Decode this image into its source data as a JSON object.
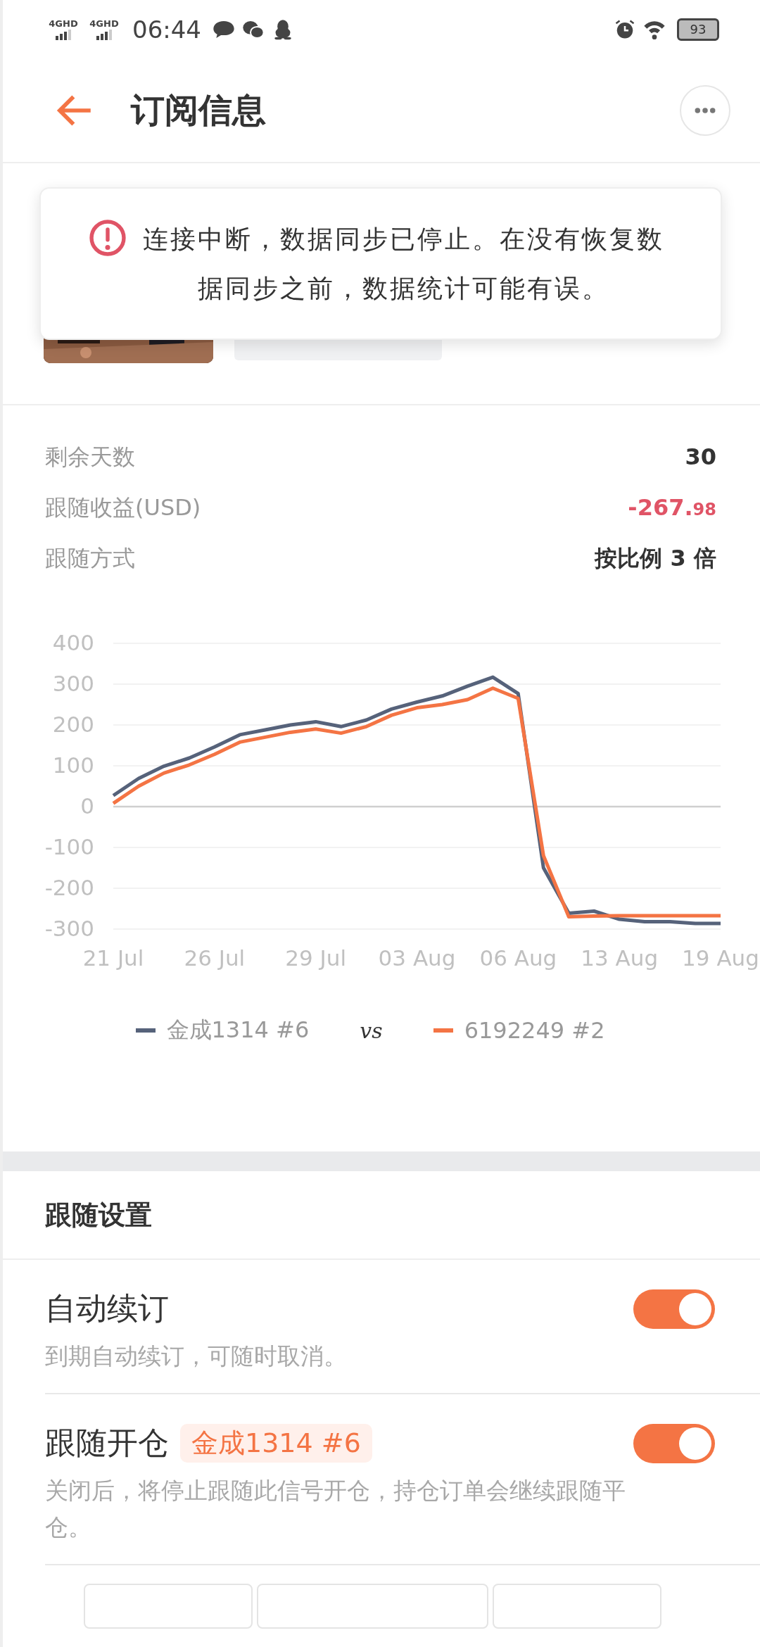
{
  "status_bar": {
    "networks": [
      "4GHD",
      "4GHD"
    ],
    "time": "06:44",
    "battery": "93"
  },
  "header": {
    "title": "订阅信息"
  },
  "toast": {
    "message": "连接中断，数据同步已停止。在没有恢复数据同步之前，数据统计可能有误。"
  },
  "info_rows": [
    {
      "label": "剩余天数",
      "value": "30",
      "color": "#333333"
    },
    {
      "label": "跟随收益(USD)",
      "value": "-267.",
      "decimals": "98",
      "color": "#e05466"
    },
    {
      "label": "跟随方式",
      "value": "按比例 3 倍",
      "color": "#333333"
    }
  ],
  "chart_data": {
    "type": "line",
    "grid": true,
    "categories": [
      "21 Jul",
      null,
      null,
      null,
      "26 Jul",
      null,
      null,
      null,
      "29 Jul",
      null,
      null,
      null,
      "03 Aug",
      null,
      null,
      null,
      "06 Aug",
      null,
      null,
      null,
      "13 Aug",
      null,
      null,
      null,
      "19 Aug"
    ],
    "ylim": [
      -300,
      400
    ],
    "yticks": [
      -300,
      -200,
      -100,
      0,
      100,
      200,
      300,
      400
    ],
    "series": [
      {
        "name": "金成1314 #6",
        "color": "#56627a",
        "values": [
          27,
          69,
          99,
          119,
          146,
          176,
          188,
          200,
          208,
          196,
          212,
          239,
          256,
          271,
          295,
          317,
          277,
          -150,
          -261,
          -256,
          -276,
          -282,
          -282,
          -286,
          -286
        ]
      },
      {
        "name": "6192249 #2",
        "color": "#f47444",
        "values": [
          8,
          50,
          82,
          102,
          128,
          158,
          170,
          182,
          190,
          180,
          196,
          224,
          242,
          250,
          262,
          290,
          265,
          -120,
          -270,
          -268,
          -267,
          -267,
          -267,
          -267,
          -267
        ]
      }
    ]
  },
  "legend": {
    "separator": "vs"
  },
  "settings": {
    "title": "跟随设置",
    "items": [
      {
        "label": "自动续订",
        "description": "到期自动续订，可随时取消。",
        "on": true
      },
      {
        "label": "跟随开仓",
        "tag": "金成1314 #6",
        "description": "关闭后，将停止跟随此信号开仓，持仓订单会继续跟随平仓。",
        "on": true
      }
    ]
  },
  "bottom_buttons": [
    {
      "kind": "outline"
    },
    {
      "kind": "outline"
    },
    {
      "kind": "outline"
    }
  ]
}
